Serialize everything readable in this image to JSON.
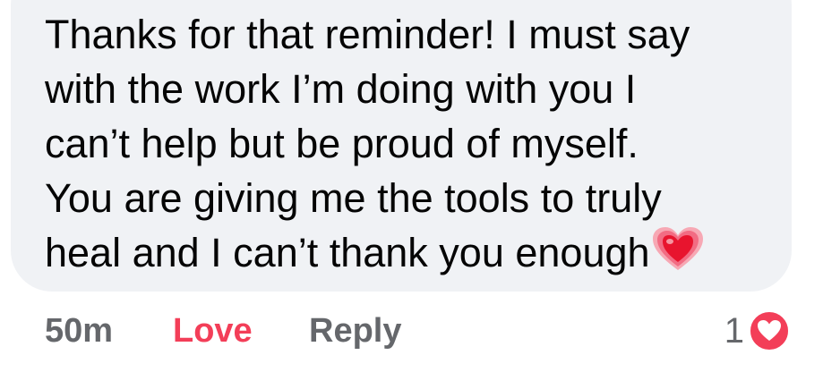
{
  "comment": {
    "lines": [
      "Thanks for that reminder! I must say",
      "with the work I’m doing with you I",
      "can’t help but be proud of myself.",
      "You are giving me the tools to truly",
      "heal and I can’t thank you enough"
    ],
    "emoji": "growing-heart-icon"
  },
  "actions": {
    "time": "50m",
    "love_label": "Love",
    "reply_label": "Reply"
  },
  "reaction": {
    "count": "1",
    "icon": "love-reaction-icon",
    "color": "#f33e58"
  },
  "colors": {
    "bubble": "#f0f2f5",
    "text": "#050505",
    "secondary": "#65676b",
    "love": "#f33e58"
  }
}
